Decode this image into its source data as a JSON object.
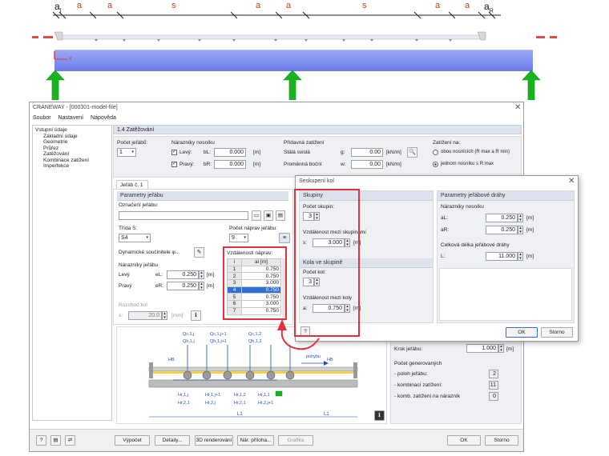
{
  "top_diagram": {
    "dims": [
      "a",
      "a",
      "a",
      "s",
      "a",
      "a",
      "s",
      "a",
      "a"
    ],
    "dim_first": "a",
    "dim_first_sub": "l",
    "dim_last": "a",
    "dim_last_sub": "R",
    "x_axis_label": "x"
  },
  "main_window": {
    "title": "CRANEWAY - [000301-model-file]",
    "menu": [
      "Soubor",
      "Nastavení",
      "Nápověda"
    ],
    "tree": {
      "root": "Vstupní údaje",
      "items": [
        "Základní údaje",
        "Geometrie",
        "Průřez",
        "Zatěžování",
        "Kombinace zatížení",
        "Imperfekce"
      ]
    },
    "section_title": "1.4 Zatěžování",
    "crane_count_label": "Počet jeřábů:",
    "crane_count_value": "1",
    "bumpers_label": "Nárazníky nosníku",
    "left_label": "Levý:",
    "left_sym": "bL:",
    "left_val": "0.000",
    "right_label": "Pravý:",
    "right_sym": "bR:",
    "right_val": "0.000",
    "unit_m": "[m]",
    "extra_load_label": "Přídavná zatížení",
    "stale_label": "Stálá svislá",
    "stale_sym": "g:",
    "stale_val": "0.00",
    "stale_unit": "[kN/m]",
    "prom_label": "Proměnná boční",
    "prom_sym": "w:",
    "prom_val": "0.00",
    "prom_unit": "[kN/m]",
    "zatizeni_label": "Zatížení na:",
    "radio1": "obou nosnících (R max a R min)",
    "radio2": "jednom nosníku s R max",
    "tab": "Jeřáb č. 1",
    "params_head": "Parametry jeřábu",
    "oznaceni": "Označení jeřábu:",
    "trida": "Třída S:",
    "trida_val": "S4",
    "pocet_naprav": "Počet náprav jeřábu:",
    "pocet_naprav_val": "9",
    "dyn": "Dynamické součinitele φ...",
    "naraz_jer": "Nárazníky jeřábu",
    "levy": "Levý",
    "levy_sym": "eL:",
    "levy_val": "0.250",
    "pravy": "Pravý",
    "pravy_sym": "eR:",
    "pravy_val": "0.250",
    "rozchod": "Rozchod kol",
    "rozchod_sym": "s:",
    "rozchod_val": "20.0",
    "rozchod_unit": "[mm]",
    "vzd_head": "Vzdálenosti náprav:",
    "vzd_col1": "i",
    "vzd_col2": "ai [m]",
    "vzd_rows": [
      {
        "i": "1",
        "v": "0.750"
      },
      {
        "i": "2",
        "v": "0.750"
      },
      {
        "i": "3",
        "v": "3.000"
      },
      {
        "i": "4",
        "v": "0.750"
      },
      {
        "i": "5",
        "v": "0.750"
      },
      {
        "i": "6",
        "v": "3.000"
      },
      {
        "i": "7",
        "v": "0.750"
      }
    ],
    "krok_label": "Krok jeřábu:",
    "krok_val": "1.000",
    "krok_unit": "[m]",
    "generated_head": "Počet generovaných",
    "gen1_label": "- poloh jeřábu:",
    "gen1_val": "2",
    "gen2_label": "- kombinací zatížení:",
    "gen2_val": "11",
    "gen3_label": "- komb. zatížení na nárazník",
    "gen3_val": "0",
    "bottom_buttons": [
      "Výpočet",
      "Detaily...",
      "3D renderování",
      "Nár. příloha...",
      "Grafika"
    ],
    "ok": "OK",
    "cancel": "Storno"
  },
  "figure": {
    "q_labels": [
      "Qc,1,j",
      "Qc,1,j+1",
      "Qc,1,2",
      "Qh,1,j",
      "Qh,1,j+1",
      "Qh,1,2"
    ],
    "h_labels": [
      "Hr,1,j",
      "Hr,1,j+1",
      "Hr,1,2",
      "Hr,1,1",
      "Hr,2,1",
      "Hr,2,j",
      "Hr,2,1",
      "Hr,2,j+1"
    ],
    "dir_label": "pohybu",
    "hb_label": "HB",
    "l1": "L1",
    "l2": "L1"
  },
  "dialog": {
    "title": "Seskupení kol",
    "skupiny_head": "Skupiny",
    "pocet_skupin": "Počet skupin:",
    "pocet_skupin_val": "3",
    "vzd_skupin": "Vzdálenost mezi skupinami",
    "vzd_skupin_sym": "s:",
    "vzd_skupin_val": "3.000",
    "kola_head": "Kola ve skupině",
    "pocet_kol": "Počet kol:",
    "pocet_kol_val": "3",
    "vzd_kol": "Vzdálenost mezi koly",
    "vzd_kol_sym": "a:",
    "vzd_kol_val": "0.750",
    "drahy_head": "Parametry jeřábové dráhy",
    "naraz_nos": "Nárazníky nosníku",
    "bL_sym": "aL:",
    "bL_val": "0.250",
    "bR_sym": "aR:",
    "bR_val": "0.250",
    "celk_label": "Celková délka jeřábové dráhy",
    "celk_sym": "L:",
    "celk_val": "11.000",
    "unit": "[m]",
    "ok": "OK",
    "cancel": "Storno"
  },
  "colors": {
    "beam": "#7f8ef0",
    "support": "#18b41e",
    "highlight": "#e2323c",
    "selected": "#2f6fd6"
  }
}
